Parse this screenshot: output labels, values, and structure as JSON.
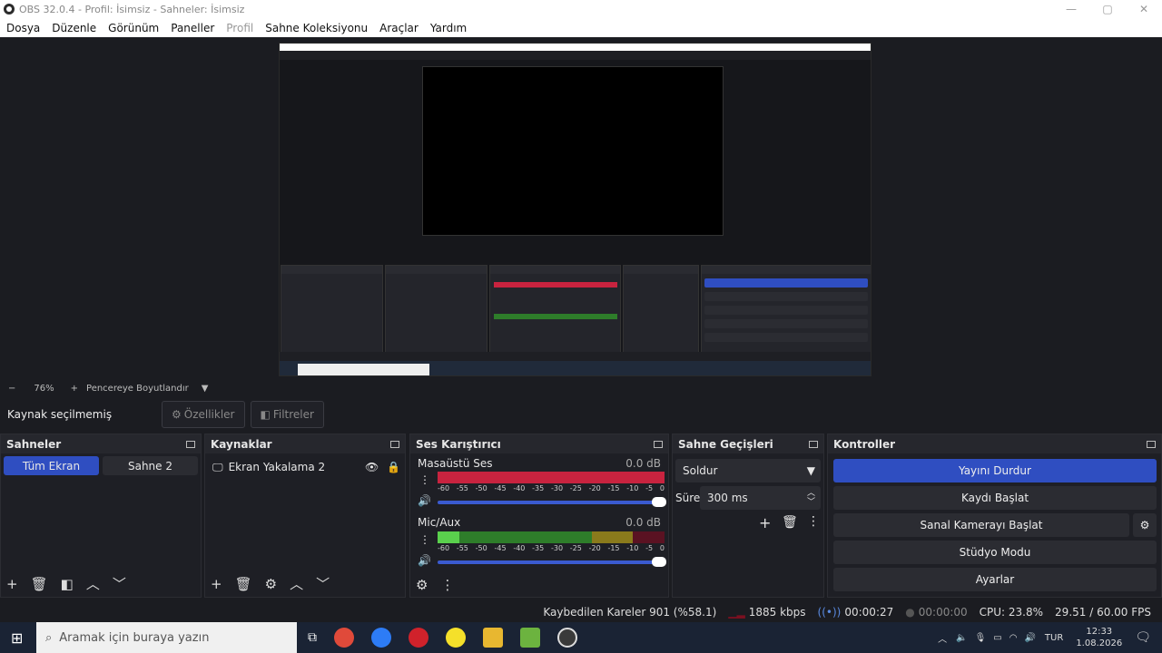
{
  "window": {
    "title": "OBS 32.0.4 - Profil: İsimsiz - Sahneler: İsimsiz"
  },
  "menu": [
    "Dosya",
    "Düzenle",
    "Görünüm",
    "Paneller",
    "Profil",
    "Sahne Koleksiyonu",
    "Araçlar",
    "Yardım"
  ],
  "zoom": {
    "minus": "−",
    "value": "76%",
    "plus": "+",
    "fit": "Pencereye Boyutlandır"
  },
  "source_bar": {
    "label": "Kaynak seçilmemiş",
    "properties": "Özellikler",
    "filters": "Filtreler"
  },
  "scenes": {
    "title": "Sahneler",
    "items": [
      "Tüm Ekran",
      "Sahne 2"
    ]
  },
  "sources": {
    "title": "Kaynaklar",
    "items": [
      "Ekran Yakalama 2"
    ]
  },
  "mixer": {
    "title": "Ses Karıştırıcı",
    "channels": [
      {
        "name": "Masaüstü Ses",
        "db": "0.0 dB"
      },
      {
        "name": "Mic/Aux",
        "db": "0.0 dB"
      }
    ],
    "ticks": [
      "-60",
      "-55",
      "-50",
      "-45",
      "-40",
      "-35",
      "-30",
      "-25",
      "-20",
      "-15",
      "-10",
      "-5",
      "0"
    ]
  },
  "transitions": {
    "title": "Sahne Geçişleri",
    "type": "Soldur",
    "duration_label": "Süre",
    "duration": "300 ms"
  },
  "controls": {
    "title": "Kontroller",
    "buttons": [
      "Yayını Durdur",
      "Kaydı Başlat",
      "Sanal Kamerayı Başlat",
      "Stüdyo Modu",
      "Ayarlar"
    ]
  },
  "status": {
    "dropped": "Kaybedilen Kareler 901 (%58.1)",
    "bitrate": "1885 kbps",
    "stream_time": "00:00:27",
    "rec_time": "00:00:00",
    "cpu": "CPU: 23.8%",
    "fps": "29.51 / 60.00 FPS"
  },
  "taskbar": {
    "search_placeholder": "Aramak için buraya yazın",
    "lang": "TUR",
    "time": "12:33",
    "date": "1.08.2026"
  },
  "colors": {
    "accent": "#2f4ec1",
    "meter_red": "#c8233f",
    "meter_green": "#3fbf3a"
  }
}
